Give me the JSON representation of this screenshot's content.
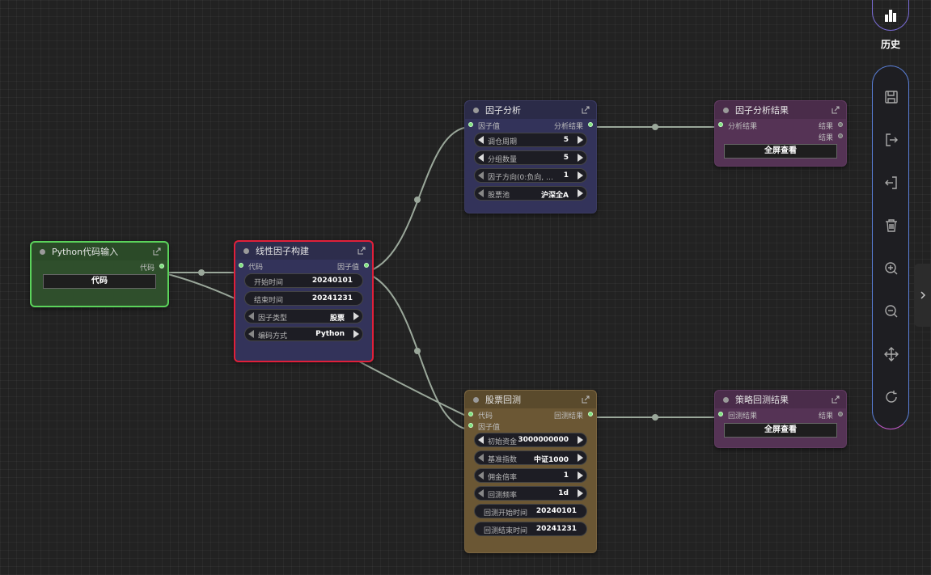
{
  "sidebar": {
    "history_label": "历史"
  },
  "nodes": {
    "python_input": {
      "title": "Python代码输入",
      "out_port": "代码",
      "button": "代码"
    },
    "linear_factor": {
      "title": "线性因子构建",
      "in_port": "代码",
      "out_port": "因子值",
      "fields": [
        {
          "label": "开始时间",
          "value": "20240101"
        },
        {
          "label": "结束时间",
          "value": "20241231"
        },
        {
          "label": "因子类型",
          "value": "股票"
        },
        {
          "label": "编码方式",
          "value": "Python"
        }
      ]
    },
    "factor_analysis": {
      "title": "因子分析",
      "in_port": "因子值",
      "out_port": "分析结果",
      "fields": [
        {
          "label": "调仓周期",
          "value": "5"
        },
        {
          "label": "分组数量",
          "value": "5"
        },
        {
          "label": "因子方向(0:负向, …",
          "value": "1"
        },
        {
          "label": "股票池",
          "value": "沪深全A"
        }
      ]
    },
    "factor_analysis_result": {
      "title": "因子分析结果",
      "in_port": "分析结果",
      "out_port_1": "结果",
      "out_port_2": "结果",
      "button": "全屏查看"
    },
    "stock_backtest": {
      "title": "股票回测",
      "in_port_1": "代码",
      "in_port_2": "因子值",
      "out_port": "回测结果",
      "fields": [
        {
          "label": "初始资金",
          "value": "3000000000"
        },
        {
          "label": "基准指数",
          "value": "中证1000"
        },
        {
          "label": "佣金倍率",
          "value": "1"
        },
        {
          "label": "回测频率",
          "value": "1d"
        },
        {
          "label": "回测开始时间",
          "value": "20240101"
        },
        {
          "label": "回测结束时间",
          "value": "20241231"
        }
      ]
    },
    "strategy_backtest_result": {
      "title": "策略回测结果",
      "in_port": "回测结果",
      "out_port": "结果",
      "button": "全屏查看"
    }
  },
  "colors": {
    "canvas": "#222222",
    "wire": "#9aa79a",
    "python_node": "#2f4f2c",
    "factor_node": "#33335a",
    "result_node": "#553355",
    "backtest_node": "#6b5734",
    "selected_border": "#e0203a",
    "input_border": "#5bd35b"
  }
}
